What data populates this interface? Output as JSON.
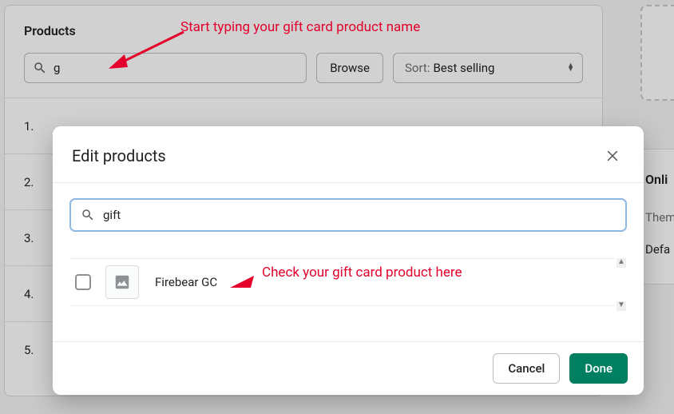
{
  "bg": {
    "title": "Products",
    "search_value": "g",
    "browse_label": "Browse",
    "sort_prefix": "Sort:",
    "sort_value": "Best selling",
    "items": [
      "1.",
      "2.",
      "3.",
      "4.",
      "5."
    ]
  },
  "side": {
    "heading": "Onli",
    "subhead": "Theme",
    "row": "Defa"
  },
  "annotations": {
    "top": "Start typing your gift card product name",
    "mid": "Check your gift card product here",
    "color": "#e4002b"
  },
  "modal": {
    "title": "Edit products",
    "search_value": "gift",
    "items": [
      {
        "name": "Firebear GC",
        "checked": false
      }
    ],
    "cancel_label": "Cancel",
    "done_label": "Done"
  },
  "icons": {
    "search": "search-icon",
    "close": "close-icon",
    "image_placeholder": "image-placeholder-icon",
    "sort_caret": "sort-caret-icon",
    "scroll_up": "scroll-up-icon",
    "scroll_down": "scroll-down-icon",
    "arrow": "annotation-arrow-icon",
    "triangle": "annotation-triangle-icon"
  },
  "colors": {
    "primary": "#008060",
    "danger": "#e4002b"
  }
}
